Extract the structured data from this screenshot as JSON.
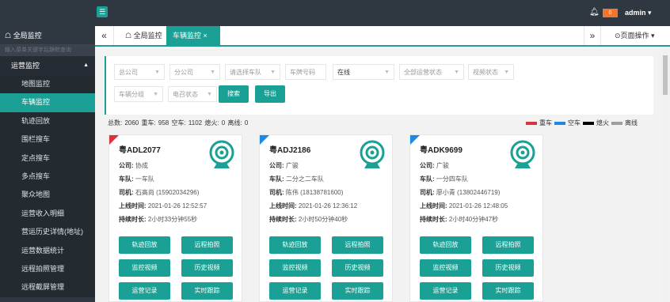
{
  "header": {
    "menu_icon": "menu-icon",
    "bell_icon": "bell-icon",
    "badge": "0",
    "user": "admin ▾"
  },
  "sidebar": {
    "global": "☖ 全局监控",
    "search_placeholder": "输入菜单关键字后静默查询",
    "group": "运营监控",
    "items": [
      "地图监控",
      "车辆监控",
      "轨迹回放",
      "围栏搜车",
      "定点搜车",
      "多点搜车",
      "聚众地图",
      "运营收入明细",
      "营运历史详情(地址)",
      "运营数据统计",
      "远程拍照管理",
      "远程截屏管理"
    ]
  },
  "tabs": {
    "prev": "«",
    "tab1": "☖ 全局监控",
    "tab2": "车辆监控 ×",
    "next": "»",
    "page_ops": "⊙页面操作 ▾"
  },
  "filters": {
    "parent_company": "总公司",
    "branch_company": "分公司",
    "select_vehicle": "请选择车队",
    "plate_no": "车牌号码",
    "online": "在线",
    "op_status": "全部运营状态",
    "video_status": "视频状态",
    "vehicle_group": "车辆分组",
    "power_status": "电召状态",
    "search_btn": "搜索",
    "export_btn": "导出"
  },
  "stats": {
    "text": "总数: 2060 重车: 958 空车: 1102 熄火: 0 离线: 0",
    "legend": [
      "重车",
      "空车",
      "熄火",
      "离线"
    ],
    "legend_colors": [
      "#d9333f",
      "#1e88e5",
      "#000000",
      "#9e9e9e"
    ]
  },
  "cards": [
    {
      "plate": "粤ADL2077",
      "corner_color": "#d9333f",
      "company_label": "公司:",
      "company": "协成",
      "fleet_label": "车队:",
      "fleet": "一车队",
      "driver_label": "司机:",
      "driver": "石高尚 (15902034296)",
      "online_label": "上线时间:",
      "online": "2021-01-26 12:52:57",
      "duration_label": "持续时长:",
      "duration": "2小时33分钟55秒"
    },
    {
      "plate": "粤ADJ2186",
      "corner_color": "#1e88e5",
      "company_label": "公司:",
      "company": "广骏",
      "fleet_label": "车队:",
      "fleet": "二分之二车队",
      "driver_label": "司机:",
      "driver": "陈伟 (18138781600)",
      "online_label": "上线时间:",
      "online": "2021-01-26 12:36:12",
      "duration_label": "持续时长:",
      "duration": "2小时50分钟40秒"
    },
    {
      "plate": "粤ADK9699",
      "corner_color": "#1e88e5",
      "company_label": "公司:",
      "company": "广骏",
      "fleet_label": "车队:",
      "fleet": "一分四车队",
      "driver_label": "司机:",
      "driver": "廖小青 (13802446719)",
      "online_label": "上线时间:",
      "online": "2021-01-26 12:48:05",
      "duration_label": "持续时长:",
      "duration": "2小时40分钟47秒"
    }
  ],
  "card_buttons": [
    "轨迹回放",
    "远程拍照",
    "监控视频",
    "历史视频",
    "运营记录",
    "实时跟踪"
  ],
  "accent": "#1aa094"
}
